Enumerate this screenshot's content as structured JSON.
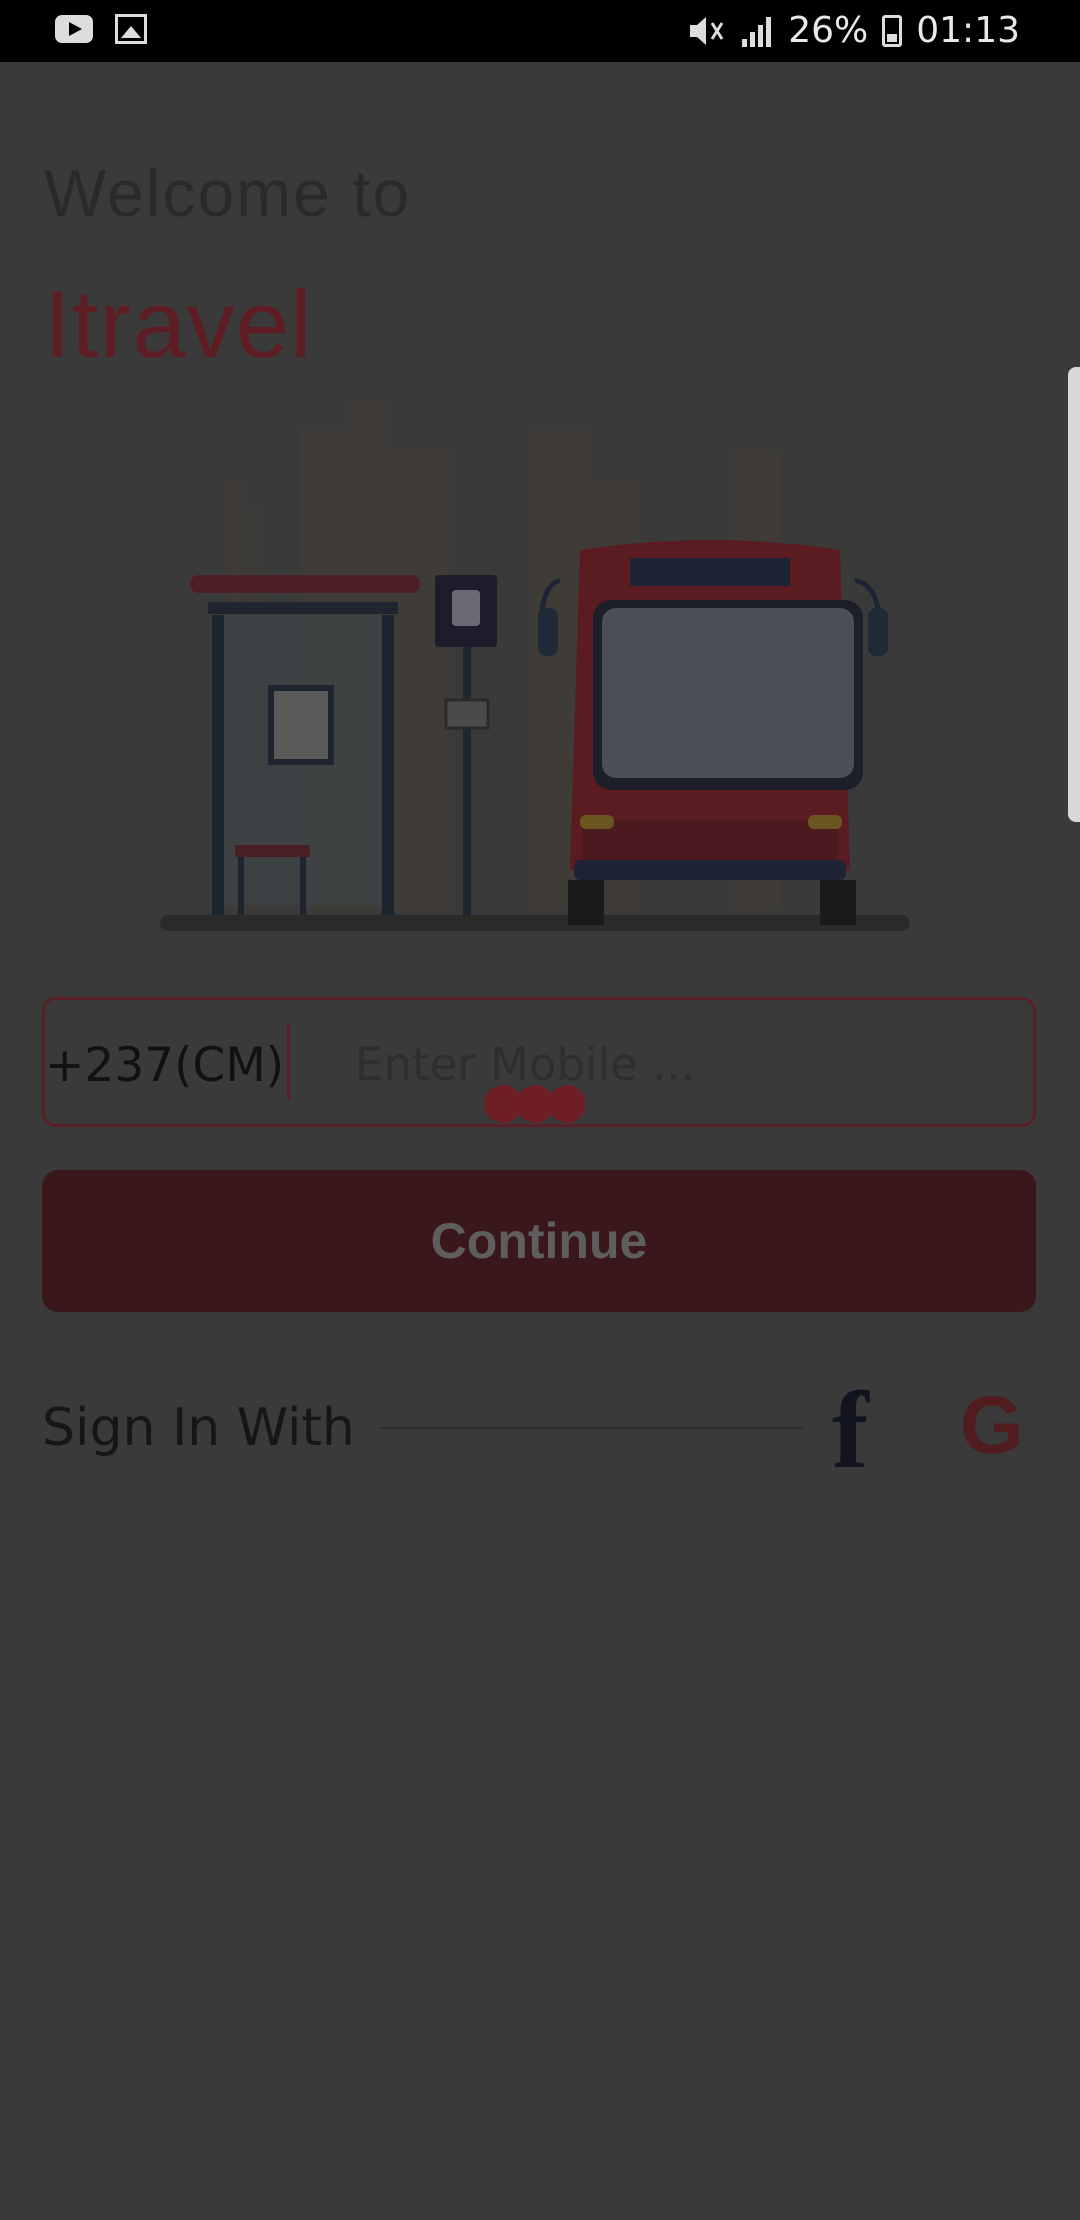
{
  "status_bar": {
    "battery": "26%",
    "time": "01:13",
    "icons": [
      "youtube-icon",
      "gallery-icon",
      "mute-icon",
      "signal-icon",
      "battery-icon"
    ]
  },
  "header": {
    "welcome": "Welcome to",
    "app_name": "Itravel"
  },
  "illustration": {
    "name": "bus-stop-illustration"
  },
  "phone": {
    "country_code": "+237(CM)",
    "placeholder": "Enter Mobile ..."
  },
  "actions": {
    "continue_label": "Continue"
  },
  "social": {
    "sign_in_label": "Sign In With",
    "facebook_letter": "f",
    "google_letter": "G"
  },
  "colors": {
    "background": "#3a3a3a",
    "accent": "#5e1d22",
    "button": "#3a171b"
  }
}
